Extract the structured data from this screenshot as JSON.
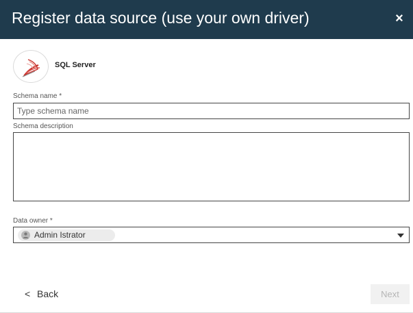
{
  "dialog": {
    "title": "Register data source (use your own driver)",
    "close_glyph": "×"
  },
  "source": {
    "name": "SQL Server",
    "icon": "sql-server-logo-icon"
  },
  "schema_name": {
    "label": "Schema name *",
    "value": "",
    "placeholder": "Type schema name"
  },
  "schema_description": {
    "label": "Schema description",
    "value": ""
  },
  "data_owner": {
    "label": "Data owner *",
    "selected": "Admin Istrator",
    "icon": "user-icon"
  },
  "footer": {
    "back_label": "Back",
    "back_glyph": "<",
    "next_label": "Next",
    "next_enabled": false
  },
  "colors": {
    "header_bg": "#1f3b4d",
    "logo_red": "#c8302a",
    "next_disabled_bg": "#f1f1f1",
    "next_disabled_text": "#b5b5b5"
  }
}
